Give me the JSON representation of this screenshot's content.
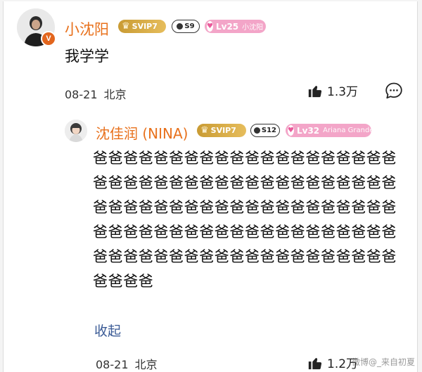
{
  "comment": {
    "username": "小沈阳",
    "vip_badge": "SVIP7",
    "season_badge": "S9",
    "level_badge": {
      "level": "Lv25",
      "fan_name": "小沈阳"
    },
    "verified_mark": "V",
    "text": "我学学",
    "date": "08-21",
    "location": "北京",
    "likes": "1.3万"
  },
  "reply": {
    "username": "沈佳润 (NINA)",
    "vip_badge": "SVIP7",
    "season_badge": "S12",
    "level_badge": {
      "level": "Lv32",
      "fan_name": "Ariana Grande"
    },
    "text": "爸爸爸爸爸爸爸爸爸爸爸爸爸爸爸爸爸爸爸爸爸爸爸爸爸爸爸爸爸爸爸爸爸爸爸爸爸爸爸爸爸爸爸爸爸爸爸爸爸爸爸爸爸爸爸爸爸爸爸爸爸爸爸爸爸爸爸爸爸爸爸爸爸爸爸爸爸爸爸爸爸爸爸爸爸爸爸爸爸爸爸爸爸爸爸爸爸爸爸爸爸爸爸爸",
    "collapse_label": "收起",
    "date": "08-21",
    "location": "北京",
    "likes": "1.2万"
  },
  "watermark": "微博@_来自初夏",
  "icons": {
    "like": "thumbs-up-icon",
    "comment": "comment-bubble-icon",
    "heart": "heart-icon"
  },
  "colors": {
    "username": "#e8711c",
    "svip_gold": "#d4a53f",
    "level_pink": "#f3a5c8",
    "collapse_link": "#3b5b96",
    "verified": "#e2651d"
  }
}
